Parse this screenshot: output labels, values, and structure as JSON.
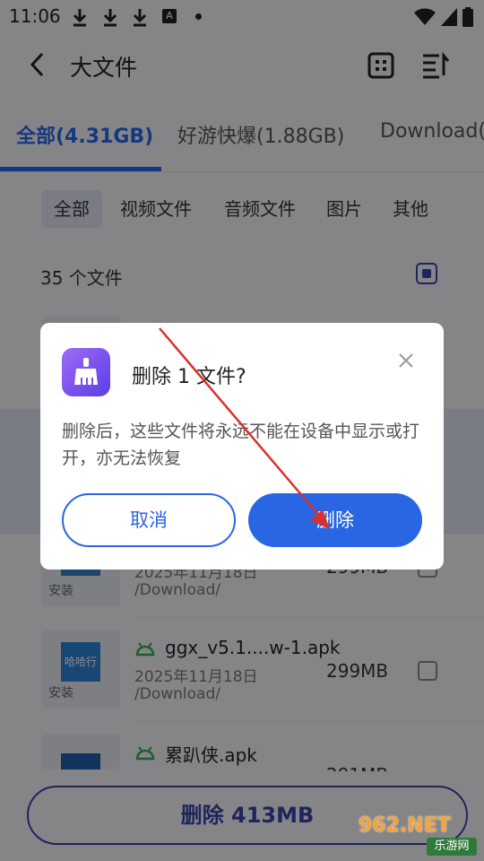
{
  "status_bar": {
    "time": "11:06",
    "a_label": "A"
  },
  "header": {
    "title": "大文件"
  },
  "tabs": [
    {
      "label": "全部(4.31GB)"
    },
    {
      "label": "好游快爆(1.88GB)"
    },
    {
      "label": "Download("
    }
  ],
  "filters": [
    "全部",
    "视频文件",
    "音频文件",
    "图片",
    "其他"
  ],
  "file_count": "35 个文件",
  "files": [
    {
      "name": "",
      "date": "2025年11月18日",
      "path": "/Download/",
      "size": "299MB",
      "tag": "安装"
    },
    {
      "name": "ggx_v5.1....w-1.apk",
      "date": "2025年11月18日",
      "path": "/Download/",
      "size": "299MB",
      "tag": "安装",
      "thumb_text": "哈哈行"
    },
    {
      "name": "累趴侠.apk",
      "size": "291MB"
    }
  ],
  "bottom_button": {
    "label": "删除 413MB"
  },
  "dialog": {
    "title": "删除 1 文件?",
    "message": "删除后，这些文件将永远不能在设备中显示或打开，亦无法恢复",
    "cancel_label": "取消",
    "confirm_label": "删除"
  },
  "watermark": {
    "top": "962.NET",
    "bottom": "乐游网"
  },
  "colors": {
    "accent": "#2866e4",
    "dark_accent": "#3b43a8",
    "annotation": "#d9302c"
  }
}
